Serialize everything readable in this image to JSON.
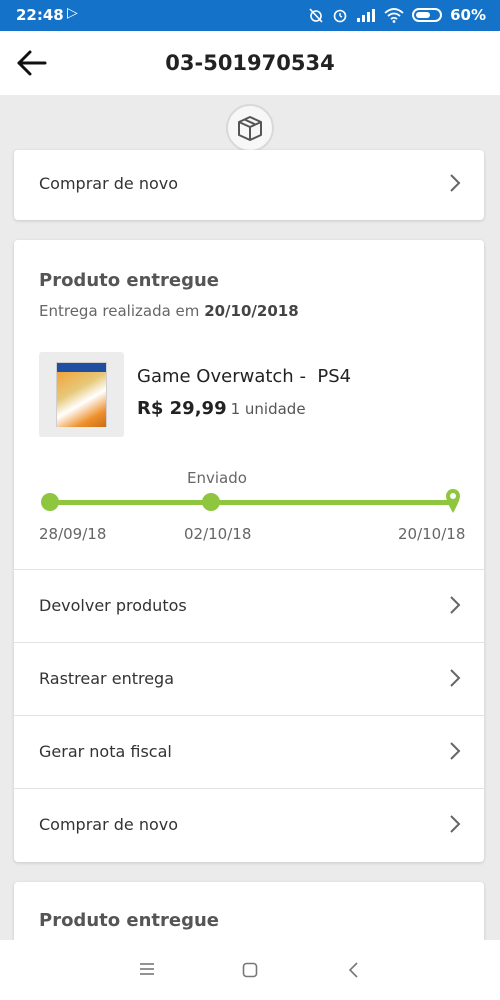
{
  "status_bar": {
    "time": "22:48",
    "battery_pct": "60%",
    "icons": [
      "play-store-icon",
      "alarm-off-icon",
      "alarm-icon",
      "signal-icon",
      "wifi-icon",
      "battery-icon"
    ]
  },
  "header": {
    "title": "03-501970534",
    "back_icon": "arrow-left-icon"
  },
  "package_icon": "package-icon",
  "first_card": {
    "row_label": "Comprar de novo"
  },
  "delivery_card": {
    "heading": "Produto entregue",
    "delivered_prefix": "Entrega realizada em",
    "delivered_date": "20/10/2018",
    "product": {
      "name": "Game Overwatch -  PS4",
      "price": "R$ 29,99",
      "quantity": "1 unidade"
    },
    "timeline": {
      "stage_label": "Enviado",
      "dates": [
        "28/09/18",
        "02/10/18",
        "20/10/18"
      ]
    },
    "actions": [
      {
        "label": "Devolver produtos"
      },
      {
        "label": "Rastrear entrega"
      },
      {
        "label": "Gerar nota fiscal"
      },
      {
        "label": "Comprar de novo"
      }
    ]
  },
  "next_card": {
    "heading": "Produto entregue"
  },
  "colors": {
    "status_bar": "#1572c9",
    "timeline": "#8fc63f",
    "background": "#ebebeb"
  },
  "nav_bar": {
    "icons": [
      "menu-icon",
      "home-icon",
      "back-icon"
    ]
  }
}
